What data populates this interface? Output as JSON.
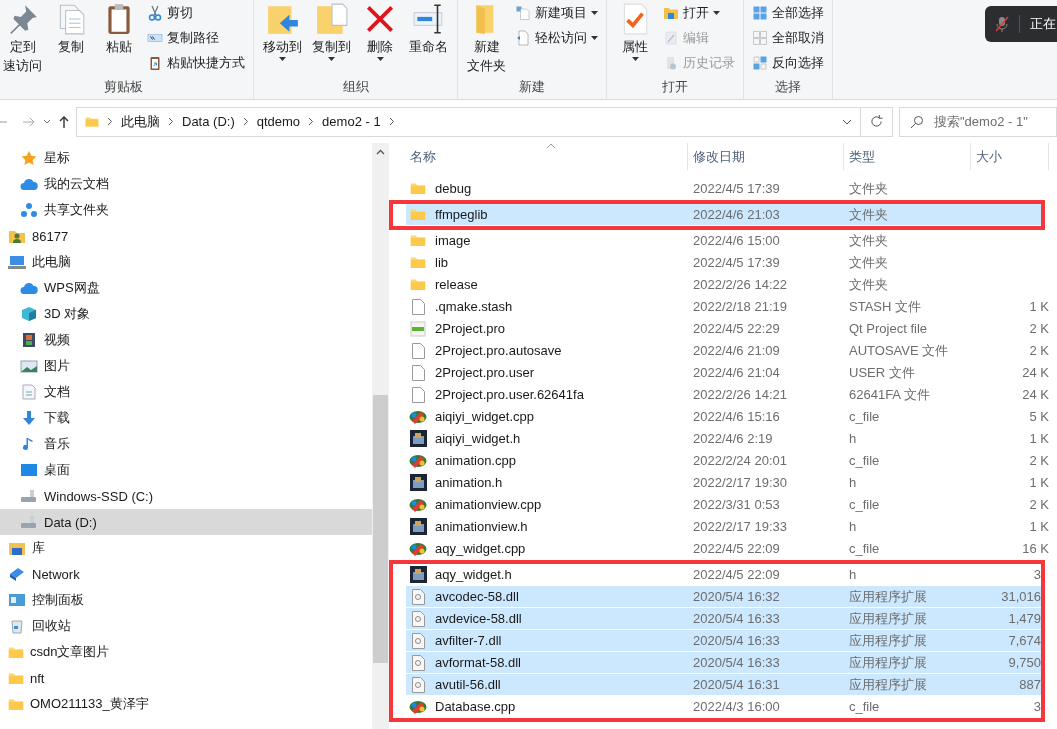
{
  "ribbon": {
    "groups": [
      {
        "label": "剪贴板",
        "large": [
          {
            "lines": [
              "定到",
              "速访问"
            ],
            "kind": "pin",
            "dropdown": false
          },
          {
            "lines": [
              "复制"
            ],
            "kind": "copy",
            "dropdown": false
          },
          {
            "lines": [
              "粘贴"
            ],
            "kind": "paste",
            "dropdown": false
          }
        ],
        "small": [
          {
            "label": "剪切",
            "kind": "cut",
            "dropdown": false,
            "disabled": false
          },
          {
            "label": "复制路径",
            "kind": "path",
            "dropdown": false,
            "disabled": false
          },
          {
            "label": "粘贴快捷方式",
            "kind": "shortcut",
            "dropdown": false,
            "disabled": false
          }
        ]
      },
      {
        "label": "组织",
        "large": [
          {
            "lines": [
              "移动到"
            ],
            "kind": "move",
            "dropdown": true
          },
          {
            "lines": [
              "复制到"
            ],
            "kind": "copyto",
            "dropdown": true
          },
          {
            "lines": [
              "删除"
            ],
            "kind": "delete",
            "dropdown": true
          },
          {
            "lines": [
              "重命名"
            ],
            "kind": "rename",
            "dropdown": false
          }
        ]
      },
      {
        "label": "新建",
        "large": [
          {
            "lines": [
              "新建",
              "文件夹"
            ],
            "kind": "newfolder",
            "dropdown": false
          }
        ],
        "small": [
          {
            "label": "新建项目",
            "kind": "newitem",
            "dropdown": true,
            "disabled": false
          },
          {
            "label": "轻松访问",
            "kind": "easy",
            "dropdown": true,
            "disabled": false
          }
        ]
      },
      {
        "label": "打开",
        "large": [
          {
            "lines": [
              "属性"
            ],
            "kind": "props",
            "dropdown": true
          }
        ],
        "small": [
          {
            "label": "打开",
            "kind": "open",
            "dropdown": true,
            "disabled": false
          },
          {
            "label": "编辑",
            "kind": "edit",
            "dropdown": false,
            "disabled": true
          },
          {
            "label": "历史记录",
            "kind": "history",
            "dropdown": false,
            "disabled": true
          }
        ]
      },
      {
        "label": "选择",
        "small": [
          {
            "label": "全部选择",
            "kind": "selall",
            "dropdown": false,
            "disabled": false
          },
          {
            "label": "全部取消",
            "kind": "selnone",
            "dropdown": false,
            "disabled": false
          },
          {
            "label": "反向选择",
            "kind": "selinv",
            "dropdown": false,
            "disabled": false
          }
        ]
      }
    ]
  },
  "toast": {
    "text": "正在"
  },
  "address": {
    "path": [
      "此电脑",
      "Data (D:)",
      "qtdemo",
      "demo2 - 1"
    ]
  },
  "search": {
    "placeholder": "搜索\"demo2 - 1\""
  },
  "sidebar": {
    "pinned": [
      {
        "label": "星标",
        "kind": "star",
        "selected": false
      },
      {
        "label": "我的云文档",
        "kind": "cloud",
        "selected": false
      },
      {
        "label": "共享文件夹",
        "kind": "share",
        "selected": false
      }
    ],
    "items": [
      {
        "label": "86177",
        "kind": "user",
        "selected": false
      },
      {
        "label": "此电脑",
        "kind": "pc",
        "selected": false,
        "children": [
          {
            "label": "WPS网盘",
            "kind": "cloud",
            "selected": false
          },
          {
            "label": "3D 对象",
            "kind": "cube",
            "selected": false
          },
          {
            "label": "视频",
            "kind": "video",
            "selected": false
          },
          {
            "label": "图片",
            "kind": "picture",
            "selected": false
          },
          {
            "label": "文档",
            "kind": "doc",
            "selected": false
          },
          {
            "label": "下载",
            "kind": "download",
            "selected": false
          },
          {
            "label": "音乐",
            "kind": "music",
            "selected": false
          },
          {
            "label": "桌面",
            "kind": "desktop",
            "selected": false
          },
          {
            "label": "Windows-SSD (C:)",
            "kind": "drive",
            "selected": false
          },
          {
            "label": "Data (D:)",
            "kind": "drive",
            "selected": true
          }
        ]
      },
      {
        "label": "库",
        "kind": "library",
        "selected": false
      },
      {
        "label": "Network",
        "kind": "network",
        "selected": false
      },
      {
        "label": "控制面板",
        "kind": "control",
        "selected": false
      },
      {
        "label": "回收站",
        "kind": "recycle",
        "selected": false
      },
      {
        "label": "csdn文章图片",
        "kind": "folder",
        "selected": false
      },
      {
        "label": "nft",
        "kind": "folder",
        "selected": false
      },
      {
        "label": "OMO211133_黄泽宇",
        "kind": "folder",
        "selected": false
      }
    ]
  },
  "table": {
    "columns": [
      "名称",
      "修改日期",
      "类型",
      "大小"
    ],
    "row_groups": [
      {
        "framed": false,
        "rows": [
          {
            "name": "debug",
            "date": "2022/4/5 17:39",
            "type": "文件夹",
            "size": "",
            "kind": "folder",
            "selected": false
          }
        ]
      },
      {
        "framed": true,
        "rows": [
          {
            "name": "ffmpeglib",
            "date": "2022/4/6 21:03",
            "type": "文件夹",
            "size": "",
            "kind": "folder",
            "selected": true
          }
        ]
      },
      {
        "framed": false,
        "rows": [
          {
            "name": "image",
            "date": "2022/4/6 15:00",
            "type": "文件夹",
            "size": "",
            "kind": "folder",
            "selected": false
          },
          {
            "name": "lib",
            "date": "2022/4/5 17:39",
            "type": "文件夹",
            "size": "",
            "kind": "folder",
            "selected": false
          },
          {
            "name": "release",
            "date": "2022/2/26 14:22",
            "type": "文件夹",
            "size": "",
            "kind": "folder",
            "selected": false
          },
          {
            "name": ".qmake.stash",
            "date": "2022/2/18 21:19",
            "type": "STASH 文件",
            "size": "1 K",
            "kind": "file",
            "selected": false
          },
          {
            "name": "2Project.pro",
            "date": "2022/4/5 22:29",
            "type": "Qt Project file",
            "size": "2 K",
            "kind": "pro",
            "selected": false
          },
          {
            "name": "2Project.pro.autosave",
            "date": "2022/4/6 21:09",
            "type": "AUTOSAVE 文件",
            "size": "2 K",
            "kind": "file",
            "selected": false
          },
          {
            "name": "2Project.pro.user",
            "date": "2022/4/6 21:04",
            "type": "USER 文件",
            "size": "24 K",
            "kind": "file",
            "selected": false
          },
          {
            "name": "2Project.pro.user.62641fa",
            "date": "2022/2/26 14:21",
            "type": "62641FA 文件",
            "size": "24 K",
            "kind": "file",
            "selected": false
          },
          {
            "name": "aiqiyi_widget.cpp",
            "date": "2022/4/6 15:16",
            "type": "c_file",
            "size": "5 K",
            "kind": "cpp",
            "selected": false
          },
          {
            "name": "aiqiyi_widget.h",
            "date": "2022/4/6 2:19",
            "type": "h",
            "size": "1 K",
            "kind": "h",
            "selected": false
          },
          {
            "name": "animation.cpp",
            "date": "2022/2/24 20:01",
            "type": "c_file",
            "size": "2 K",
            "kind": "cpp",
            "selected": false
          },
          {
            "name": "animation.h",
            "date": "2022/2/17 19:30",
            "type": "h",
            "size": "1 K",
            "kind": "h",
            "selected": false
          },
          {
            "name": "animationview.cpp",
            "date": "2022/3/31 0:53",
            "type": "c_file",
            "size": "2 K",
            "kind": "cpp",
            "selected": false
          },
          {
            "name": "animationview.h",
            "date": "2022/2/17 19:33",
            "type": "h",
            "size": "1 K",
            "kind": "h",
            "selected": false
          },
          {
            "name": "aqy_widget.cpp",
            "date": "2022/4/5 22:09",
            "type": "c_file",
            "size": "16 K",
            "kind": "cpp",
            "selected": false
          }
        ]
      },
      {
        "framed": true,
        "rows": [
          {
            "name": "aqy_widget.h",
            "date": "2022/4/5 22:09",
            "type": "h",
            "size": "3",
            "kind": "h",
            "selected": false
          },
          {
            "name": "avcodec-58.dll",
            "date": "2020/5/4 16:32",
            "type": "应用程序扩展",
            "size": "31,016",
            "kind": "dll",
            "selected": true
          },
          {
            "name": "avdevice-58.dll",
            "date": "2020/5/4 16:33",
            "type": "应用程序扩展",
            "size": "1,479",
            "kind": "dll",
            "selected": true
          },
          {
            "name": "avfilter-7.dll",
            "date": "2020/5/4 16:33",
            "type": "应用程序扩展",
            "size": "7,674",
            "kind": "dll",
            "selected": true
          },
          {
            "name": "avformat-58.dll",
            "date": "2020/5/4 16:33",
            "type": "应用程序扩展",
            "size": "9,750",
            "kind": "dll",
            "selected": true
          },
          {
            "name": "avutil-56.dll",
            "date": "2020/5/4 16:31",
            "type": "应用程序扩展",
            "size": "887",
            "kind": "dll",
            "selected": true
          },
          {
            "name": "Database.cpp",
            "date": "2022/4/3 16:00",
            "type": "c_file",
            "size": "3",
            "kind": "cpp",
            "selected": false
          }
        ]
      }
    ]
  }
}
